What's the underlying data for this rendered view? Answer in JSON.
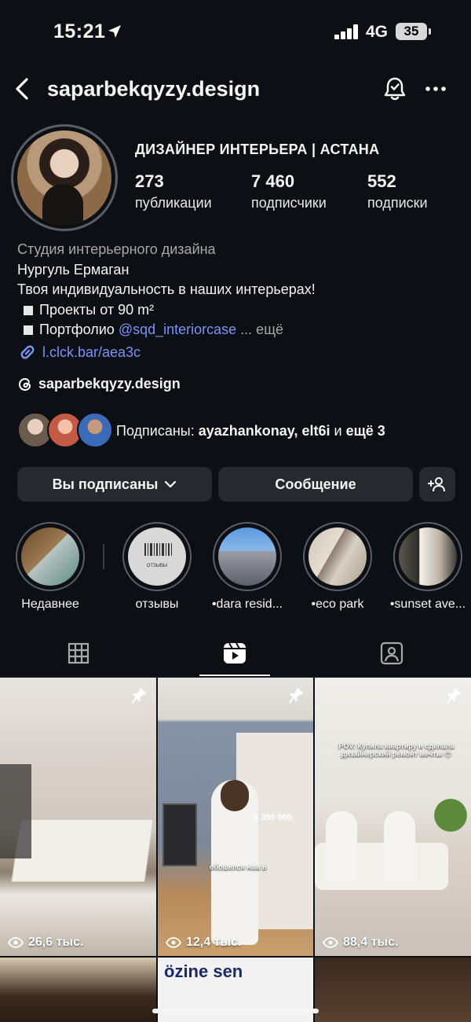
{
  "status": {
    "time": "15:21",
    "network": "4G",
    "battery": "35"
  },
  "header": {
    "username": "saparbekqyzy.design"
  },
  "profile": {
    "category": "ДИЗАЙНЕР ИНТЕРЬЕРА | АСТАНА",
    "stats": [
      {
        "value": "273",
        "label": "публикации"
      },
      {
        "value": "7 460",
        "label": "подписчики"
      },
      {
        "value": "552",
        "label": "подписки"
      }
    ],
    "bio": {
      "category_line": "Студия интерьерного дизайна",
      "name": "Нургуль Ермаган",
      "tagline": "Твоя индивидуальность в наших интерьерах!",
      "line1": "Проекты  от 90 m²",
      "line2_prefix": "Портфолио ",
      "mention": "@sqd_interiorcase",
      "more": " ... ещё"
    },
    "link": "l.clck.bar/aea3c",
    "threads": "saparbekqyzy.design",
    "followed_by": {
      "prefix": "Подписаны: ",
      "names": "ayazhankonay, elt6i",
      "mid": " и ",
      "rest": "ещё 3"
    }
  },
  "buttons": {
    "following": "Вы подписаны",
    "message": "Сообщение"
  },
  "highlights": [
    {
      "label": "Недавнее"
    },
    {
      "label": "отзывы"
    },
    {
      "label": "•dara resid..."
    },
    {
      "label": "•eco park"
    },
    {
      "label": "•sunset ave..."
    }
  ],
  "grid": {
    "items": [
      {
        "views": "26,6 тыс."
      },
      {
        "views": "12,4 тыс."
      },
      {
        "views": "88,4 тыс."
      }
    ],
    "overlay_texts": {
      "price": "$ 350 000",
      "caption2": "обошелся нам в",
      "pov": "POV: Купила квартиру и сделала дизайнерский ремонт мечты 😍",
      "review_sticker": "ОТЗЫВЫ",
      "bottom_sign": "özine sen"
    }
  },
  "colors": {
    "background": "#0c1014",
    "link": "#7b93f5",
    "button": "#26292e"
  }
}
